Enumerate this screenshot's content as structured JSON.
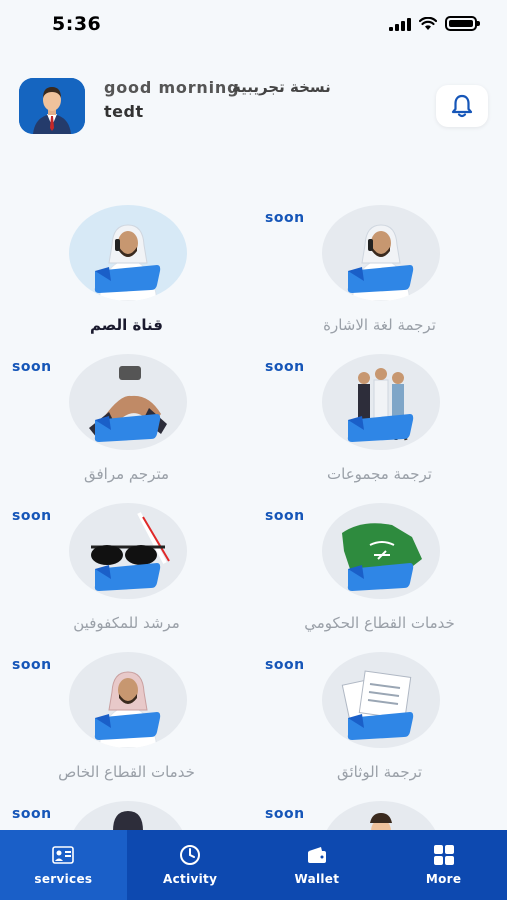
{
  "status_bar": {
    "time": "5:36"
  },
  "header": {
    "greeting": "good morning",
    "trial_label": "نسخة تجريبية",
    "username": "tedt",
    "avatar_icon": "user-avatar",
    "bell_icon": "bell-icon"
  },
  "services": [
    {
      "label": "قناة الصم",
      "soon": "",
      "icon": "man-phone-icon",
      "active": true
    },
    {
      "label": "ترجمة لغة الاشارة",
      "soon": "soon",
      "icon": "man-phone-icon",
      "active": false
    },
    {
      "label": "مترجم مرافق",
      "soon": "soon",
      "icon": "handshake-icon",
      "active": false
    },
    {
      "label": "ترجمة مجموعات",
      "soon": "soon",
      "icon": "group-icon",
      "active": false
    },
    {
      "label": "مرشد للمكفوفين",
      "soon": "soon",
      "icon": "glasses-cane-icon",
      "active": false
    },
    {
      "label": "خدمات القطاع الحكومي",
      "soon": "soon",
      "icon": "saudi-map-icon",
      "active": false
    },
    {
      "label": "خدمات القطاع الخاص",
      "soon": "soon",
      "icon": "businessman-icon",
      "active": false
    },
    {
      "label": "ترجمة الوثائق",
      "soon": "soon",
      "icon": "documents-icon",
      "active": false
    },
    {
      "label": "",
      "soon": "soon",
      "icon": "woman-icon",
      "active": false
    },
    {
      "label": "",
      "soon": "soon",
      "icon": "man-suit-icon",
      "active": false
    }
  ],
  "tabbar": {
    "tabs": [
      {
        "label": "services",
        "icon": "services-icon",
        "active": true
      },
      {
        "label": "Activity",
        "icon": "activity-icon",
        "active": false
      },
      {
        "label": "Wallet",
        "icon": "wallet-icon",
        "active": false
      },
      {
        "label": "More",
        "icon": "grid-icon",
        "active": false
      }
    ]
  },
  "colors": {
    "primary": "#0d49b0",
    "accent": "#1656b8",
    "background": "#f5f8fb"
  }
}
